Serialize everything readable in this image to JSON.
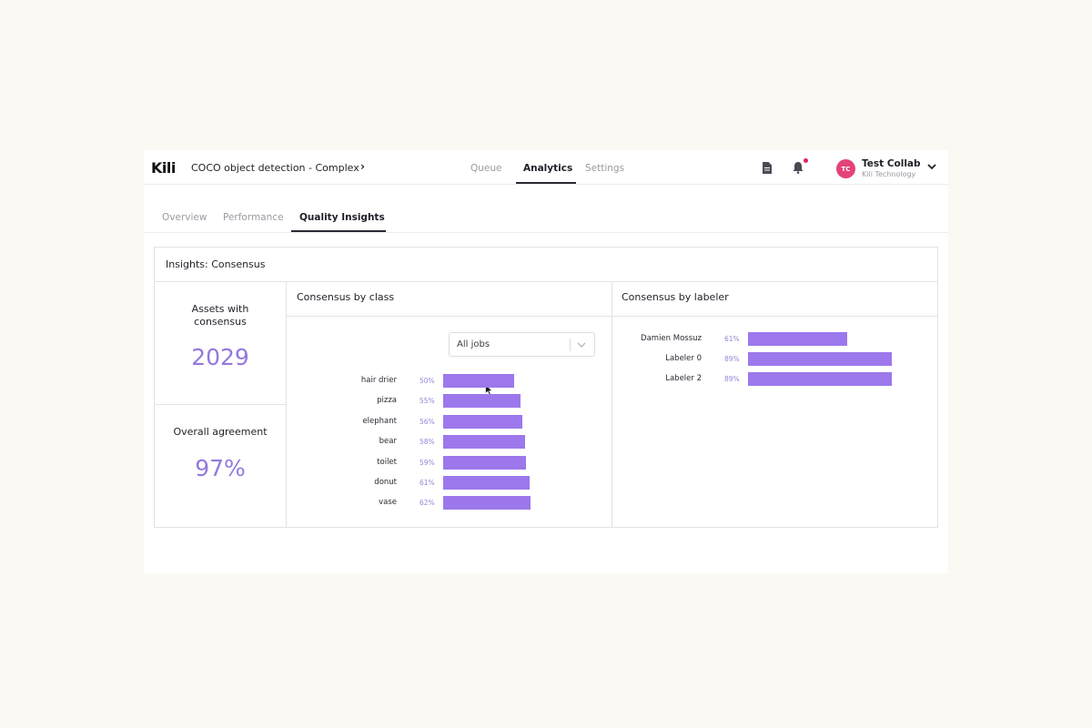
{
  "header": {
    "logo": "Kili",
    "project_title": "COCO object detection - Complex",
    "project_chevron": "›",
    "nav_tabs": [
      {
        "label": "Queue",
        "active": false
      },
      {
        "label": "Analytics",
        "active": true
      },
      {
        "label": "Settings",
        "active": false
      }
    ],
    "user": {
      "initials": "TC",
      "name": "Test Collab",
      "org": "Kili Technology"
    }
  },
  "sub_tabs": [
    {
      "label": "Overview",
      "active": false
    },
    {
      "label": "Performance",
      "active": false
    },
    {
      "label": "Quality Insights",
      "active": true
    }
  ],
  "card": {
    "title": "Insights: Consensus",
    "assets_with_consensus": {
      "label": "Assets with consensus",
      "value": "2029"
    },
    "overall_agreement": {
      "label": "Overall agreement",
      "value": "97%"
    },
    "by_class": {
      "title": "Consensus by class",
      "select_value": "All jobs"
    },
    "by_labeler": {
      "title": "Consensus by labeler"
    }
  },
  "chart_data": [
    {
      "type": "bar",
      "orientation": "horizontal",
      "title": "Consensus by class",
      "categories": [
        "hair drier",
        "pizza",
        "elephant",
        "bear",
        "toilet",
        "donut",
        "vase"
      ],
      "values": [
        50,
        55,
        56,
        58,
        59,
        61,
        62
      ],
      "value_labels": [
        "50%",
        "55%",
        "56%",
        "58%",
        "59%",
        "61%",
        "62%"
      ],
      "color": "#9c78ec"
    },
    {
      "type": "bar",
      "orientation": "horizontal",
      "title": "Consensus by labeler",
      "categories": [
        "Damien Mossuz",
        "Labeler 0",
        "Labeler 2"
      ],
      "values": [
        61,
        89,
        89
      ],
      "value_labels": [
        "61%",
        "89%",
        "89%"
      ],
      "color": "#9c78ec"
    }
  ],
  "colors": {
    "accent": "#9c78ec",
    "stat_value": "#9478dc",
    "avatar": "#e3427a",
    "notification": "#e0245e"
  }
}
